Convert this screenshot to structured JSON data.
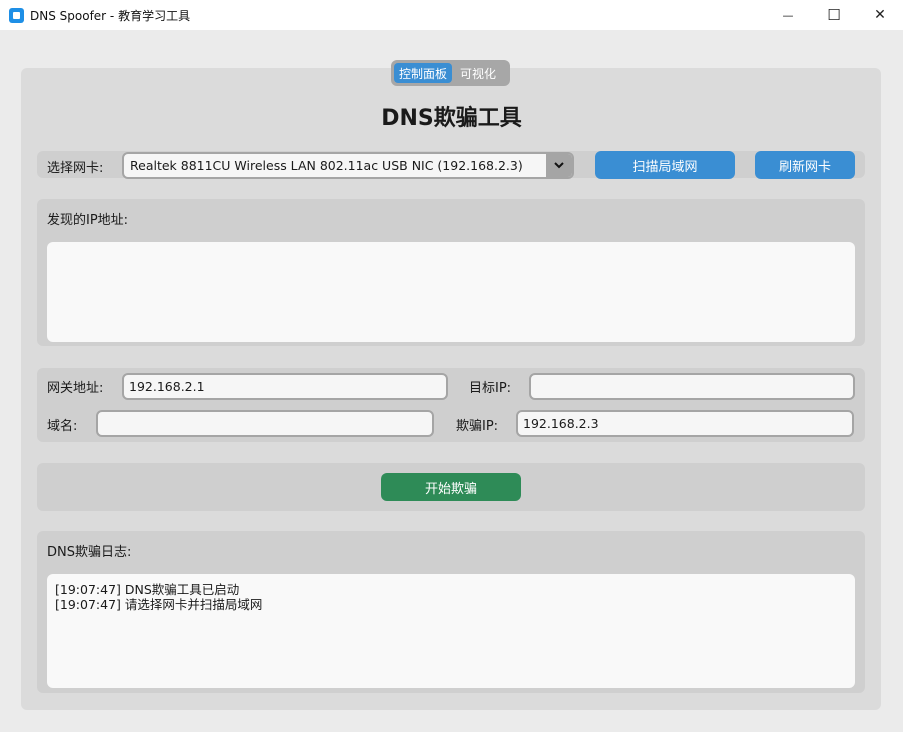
{
  "window": {
    "title": "DNS Spoofer - 教育学习工具",
    "minimize_glyph": "—",
    "maximize_glyph": "☐",
    "close_glyph": "✕"
  },
  "tabs": [
    {
      "label": "控制面板",
      "active": true
    },
    {
      "label": "可视化",
      "active": false
    }
  ],
  "heading": "DNS欺骗工具",
  "adapter": {
    "label": "选择网卡:",
    "selected": "Realtek 8811CU Wireless LAN 802.11ac USB NIC (192.168.2.3)",
    "scan_button": "扫描局域网",
    "refresh_button": "刷新网卡"
  },
  "discovered": {
    "label": "发现的IP地址:",
    "content": ""
  },
  "config": {
    "gateway_label": "网关地址:",
    "gateway_value": "192.168.2.1",
    "target_label": "目标IP:",
    "target_value": "",
    "domain_label": "域名:",
    "domain_value": "",
    "spoof_ip_label": "欺骗IP:",
    "spoof_ip_value": "192.168.2.3"
  },
  "action": {
    "start_button": "开始欺骗"
  },
  "log": {
    "label": "DNS欺骗日志:",
    "lines": [
      "[19:07:47] DNS欺骗工具已启动",
      "[19:07:47] 请选择网卡并扫描局域网"
    ]
  },
  "colors": {
    "accent_blue": "#3a8ed3",
    "start_green": "#2e8b57"
  }
}
